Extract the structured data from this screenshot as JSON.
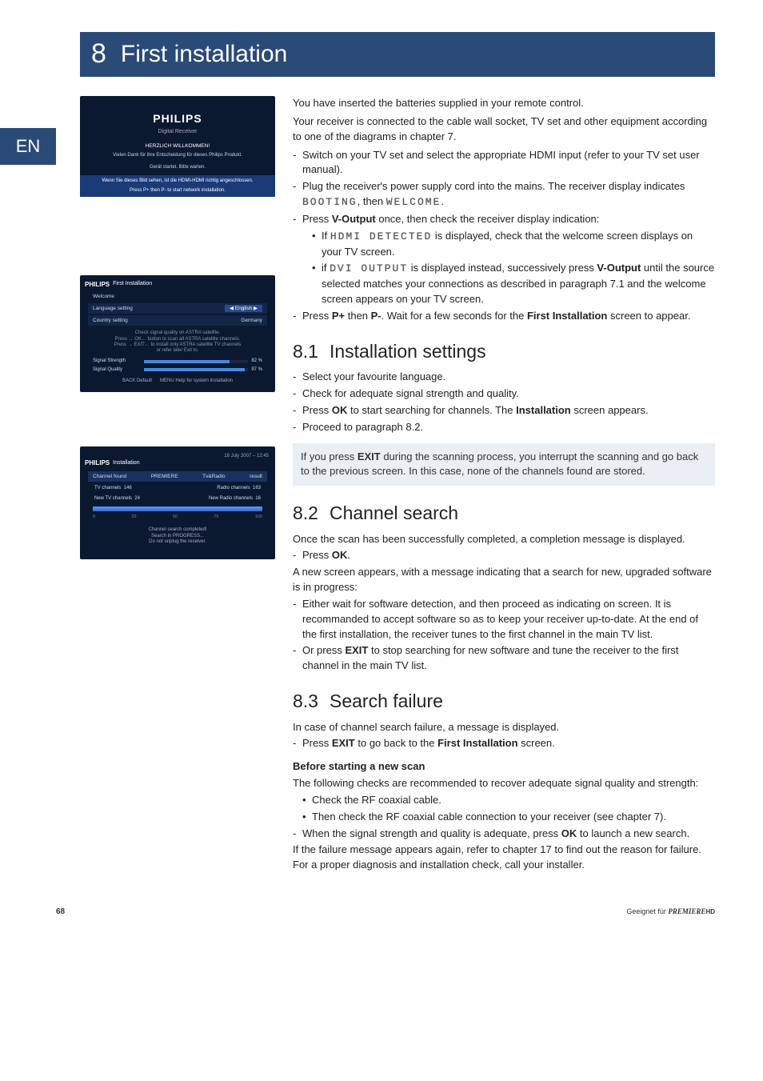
{
  "lang_tab": "EN",
  "chapter": {
    "number": "8",
    "title": "First installation"
  },
  "screenshots": {
    "welcome": {
      "brand": "PHILIPS",
      "subtitle": "Digital Receiver",
      "line1": "HERZLICH WILLKOMMEN!",
      "line2": "Vielen Dank für ihre Entscheidung für dieses Philips Produkt.",
      "line3": "Gerät startet. Bitte warten.",
      "bar1": "Wenn Sie dieses Bild sehen, ist die HDMI-HDMI richtig angeschlossen.",
      "bar2": "Press  P+  then  P-  to start network installation."
    },
    "firstinstall": {
      "header_brand": "PHILIPS",
      "header_title": "First Installation",
      "crumb": "Welcome",
      "row1_label": "Language setting",
      "row1_value": "English",
      "row2_label": "Country setting",
      "row2_value": "Germany",
      "note": "Check signal quality on ASTRA satellite.\nPress → OK← button to scan all ASTRA satellite channels.\nPress → EXIT← to install only ASTRA satellite TV channels\nor refer later Exit to.",
      "sig_strength_label": "Signal Strength",
      "sig_strength_val": "82 %",
      "sig_strength_pct": 82,
      "sig_quality_label": "Signal Quality",
      "sig_quality_val": "97 %",
      "sig_quality_pct": 97,
      "footer_left": "BACK  Default",
      "footer_right": "MENU  Help for system installation"
    },
    "installation": {
      "header_brand": "PHILIPS",
      "header_title": "Installation",
      "date": "18 July 2007 – 12:45",
      "crumb": "Channel found",
      "col_premiere": "PREMIERE",
      "col_astra": "Tv&Radio",
      "col_result": "result",
      "tv_label": "TV channels",
      "tv_val": "146",
      "newtv_label": "New TV channels",
      "newtv_val": "24",
      "radio_label": "Radio channels",
      "radio_val": "163",
      "newradio_label": "New Radio channels",
      "newradio_val": "16",
      "scale": [
        "0",
        "25",
        "50",
        "75",
        "100"
      ],
      "progress_pct": 100,
      "msg": "Channel search completed!\nSearch in PROGRESS...\nDo not unplug the receiver."
    }
  },
  "intro": {
    "p1": "You have inserted the batteries supplied in your remote control.",
    "p2": "Your receiver is connected to the cable wall socket, TV set and other equipment according to one of the diagrams in chapter 7.",
    "li1": "Switch on your TV set and select the appropriate HDMI input (refer to your TV set user manual).",
    "li2a": "Plug the receiver's power supply cord into the mains. The receiver display indicates ",
    "li2_seg1": "BOOTING",
    "li2b": ", then ",
    "li2_seg2": "WELCOME",
    "li2c": ".",
    "li3a": "Press ",
    "li3_b1": "V-Output",
    "li3b": " once, then check the receiver display indication:",
    "li3_sub1a": "If  ",
    "li3_sub1_seg": "HDMI DETECTED",
    "li3_sub1b": "  is displayed, check that the welcome screen displays on your TV screen.",
    "li3_sub2a": "if  ",
    "li3_sub2_seg": "DVI   OUTPUT",
    "li3_sub2b": "  is displayed instead, successively press ",
    "li3_sub2_bold": "V-Output",
    "li3_sub2c": " until the source selected matches your connections as described in paragraph 7.1 and the welcome screen appears on your TV screen.",
    "li4a": "Press ",
    "li4_b1": "P+",
    "li4b": " then ",
    "li4_b2": "P-",
    "li4c": ". Wait for a few seconds for the ",
    "li4_b3": "First Installation",
    "li4d": " screen to appear."
  },
  "s81": {
    "num": "8.1",
    "title": "Installation settings",
    "li1": "Select your favourite language.",
    "li2": "Check for adequate signal strength and quality.",
    "li3a": "Press ",
    "li3_b": "OK",
    "li3b": " to start searching for channels. The ",
    "li3_b2": "Installation",
    "li3c": " screen appears.",
    "li4": "Proceed to paragraph 8.2.",
    "note_a": "If you press ",
    "note_b": "EXIT",
    "note_c": " during the scanning process, you interrupt the scanning and go back to the previous screen. In this case, none of the channels found are stored."
  },
  "s82": {
    "num": "8.2",
    "title": "Channel search",
    "p1": "Once the scan has been successfully completed, a completion message is displayed.",
    "li1a": "Press ",
    "li1_b": "OK",
    "li1b": ".",
    "p2": "A new screen appears, with a message indicating that a search for new, upgraded software is in progress:",
    "li2": "Either wait for software detection, and then proceed as indicating on screen. It is recommanded to accept software so as to keep your receiver up-to-date. At the end of the first installation, the receiver tunes to the first channel in the main TV list.",
    "li3a": "Or press ",
    "li3_b": "EXIT",
    "li3b": " to stop searching for new software and tune the receiver to the first channel in the main TV list."
  },
  "s83": {
    "num": "8.3",
    "title": "Search failure",
    "p1": "In case of channel search failure, a message is displayed.",
    "li1a": "Press ",
    "li1_b": "EXIT",
    "li1b": " to go back to the ",
    "li1_b2": "First Installation",
    "li1c": " screen.",
    "sub": "Before starting a new scan",
    "p2": "The following checks are recommended to recover adequate signal quality and strength:",
    "b1": "Check the RF coaxial cable.",
    "b2": "Then check the RF coaxial cable connection to your receiver (see chapter 7).",
    "li2a": "When the signal strength and quality is adequate, press ",
    "li2_b": "OK",
    "li2b": " to launch a new search.",
    "p3": "If the failure message appears again, refer to chapter 17 to find out the reason for failure. For a proper diagnosis and installation check, call your installer."
  },
  "footer": {
    "page": "68",
    "right_a": "Geeignet für ",
    "right_b": "PREMIERE",
    "right_c": "HD"
  }
}
